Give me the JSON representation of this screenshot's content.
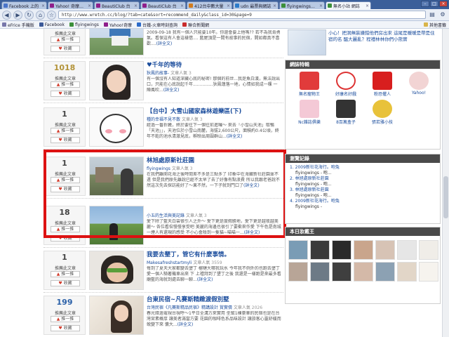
{
  "browser": {
    "tabs": [
      {
        "label": "Facebook 上的"
      },
      {
        "label": "Yahoo! 奇摩拍賣"
      },
      {
        "label": "BeautiClub 台"
      },
      {
        "label": "BeautiClub 台"
      },
      {
        "label": "412台中數大量"
      },
      {
        "label": "udn 最票與網誌"
      },
      {
        "label": "flyingwings：無"
      },
      {
        "label": "無名小站 網誌"
      }
    ],
    "url": "http://www.wretch.cc/blog/?tab=cate&sort=recommend_daily&class_id=30&page=9",
    "bookmarks": [
      "eFrice 手機版",
      "Facebook",
      "flyingwings",
      "Yahoo!奇摩",
      "台鐵-火車時刻查詢",
      "聯合新聞網"
    ],
    "other_bookmarks": "其他書籤"
  },
  "posts": [
    {
      "count": "",
      "recommend_label": "推薦此文章",
      "push_label": "推一推",
      "fav_label": "收藏",
      "title": "",
      "meta": "",
      "author": "",
      "views": "",
      "desc": "2009-09-18 我有一個人只能要10年。你還會要上他嗎??  若不為我肯勇氣。看保這有人會這樣借....  藍屋頂是一間有故事的民宿，開如都真不喜歡....",
      "more": "(詳全文)"
    },
    {
      "count": "1018",
      "recommend_label": "推薦此文章",
      "push_label": "推一推",
      "fav_label": "收藏",
      "title": "♥千年的等待",
      "meta": "狄鳳的故事-",
      "author": "文章人氣",
      "views": "3",
      "desc": "有一個沒有人知道深藏心底的秘密! 那個的前世...我是魚白漢，無法說出口，只能在心底說起千年...............狄鳳蓮落一地，心情如我成一棵 一陣風吹...",
      "more": "(詳全文)"
    },
    {
      "count": "1",
      "recommend_label": "推薦此文章",
      "push_label": "推一推",
      "fav_label": "收藏",
      "title": "【台中】大雪山國家森林遊樂區(下)",
      "meta": "種的幸福不見不散",
      "author": "文章人氣",
      "views": "3",
      "desc": "經過一番折騰，終於要往下一個往前進囉～ 來去「小雪山天池」取暢「天池」」，天池位於小雪山南麓，海拔2,600公尺，面積約0.4公頃，終年不乾的池水清澈見底，孵映出周圍群山...",
      "more": "(詳全文)"
    },
    {
      "count": "1",
      "recommend_label": "推薦此文章",
      "push_label": "推一推",
      "fav_label": "收藏",
      "title": "林旭處原新社莊園",
      "meta": "flyingwings",
      "author": "文章人氣",
      "views": "3",
      "desc": "在我們離開花海之後時間差不多是三點多了 印象中在海藏新社莊園並不遠 但是我們原先離說已經不太早了去了好像有點浪費 所以我跟老爸說不然這次先去探訪能好了～果不然，一下子就到門口了",
      "more": "(詳全文)"
    },
    {
      "count": "18",
      "recommend_label": "推薦此文章",
      "push_label": "推一推",
      "fav_label": "收藏",
      "title": "",
      "meta": "小五的生活與美記錄",
      "author": "文章人氣",
      "views": "3",
      "desc": "愛下除了藍天白雲很引人之外～ 愛下更是度假勝地，愛下更是越夜越美麗～ 各位看倌慢慢享受吧 美麗的海邊也很引了要衝來作愛 下午色是南城一煙人有還現的感受 不小心會陰到一隻貓~喵喵一...",
      "more": "(詳全文)"
    },
    {
      "count": "1",
      "recommend_label": "推薦此文章",
      "push_label": "推一推",
      "fav_label": "收藏",
      "title": "我要去墾丁，管它有什麼事情。",
      "meta": "Makesafreshstartmyli",
      "author": "文章人氣",
      "views": "3559",
      "desc": "每到了夏天大家都變去墾丁 榴槤大哪我玩水 今年我不例外的也跑去墾丁 愛一個人騎著機車出來 下 上禮拜到了墾丁之後 我還是一樣跑是來最多看 廟藍的海就到處去聊一聊...",
      "more": "(詳全文)"
    },
    {
      "count": "199",
      "recommend_label": "推薦此文章",
      "push_label": "推一推",
      "fav_label": "收藏",
      "title": "台東民宿~凡賽斯精緻渡假別墅",
      "meta": "台灣民宿《凡賽斯精品民宿》精講設計 賞實價",
      "author": "文章人氣",
      "views": "2026",
      "desc": "春光錯過電視台視呼～1平日全溝方來實用 型幫1棟豪華的民宿也是在台灣宮素概厚 讓美者滿當方要 花園的咖啡色系品味設計 讓旅客心靈舒緩而蛻變下來 慵大...",
      "more": "(詳全文)"
    }
  ],
  "right": {
    "top_text": "小心！把洞無裝嫌錯他們房出來 這尾是暖暖是帶是住宿的名 醞大麗亂？程禮林林你們小熊實",
    "hot_head": "網誌特輯",
    "hot_items": [
      "無名寵物王",
      "好康名好戲",
      "粉恐懼人",
      "Yahoo!",
      "Nc雜誌俱樂",
      "8百萬盒子",
      "張若雅小技",
      ""
    ],
    "latest_head": "瀏覽記錄",
    "latest_items": [
      {
        "title": "2009新社花海行。咆兔",
        "author": "flyingwings - 咆..."
      },
      {
        "title": "林旭處原新社莊園",
        "author": "flyingwings - 咆..."
      },
      {
        "title": "林旭處原新社莊園",
        "author": "flyingwings - 咆..."
      },
      {
        "title": "2009新社花海行。咆兔",
        "author": "flyingwings - "
      }
    ],
    "photo_head": "本日妝戴王"
  }
}
